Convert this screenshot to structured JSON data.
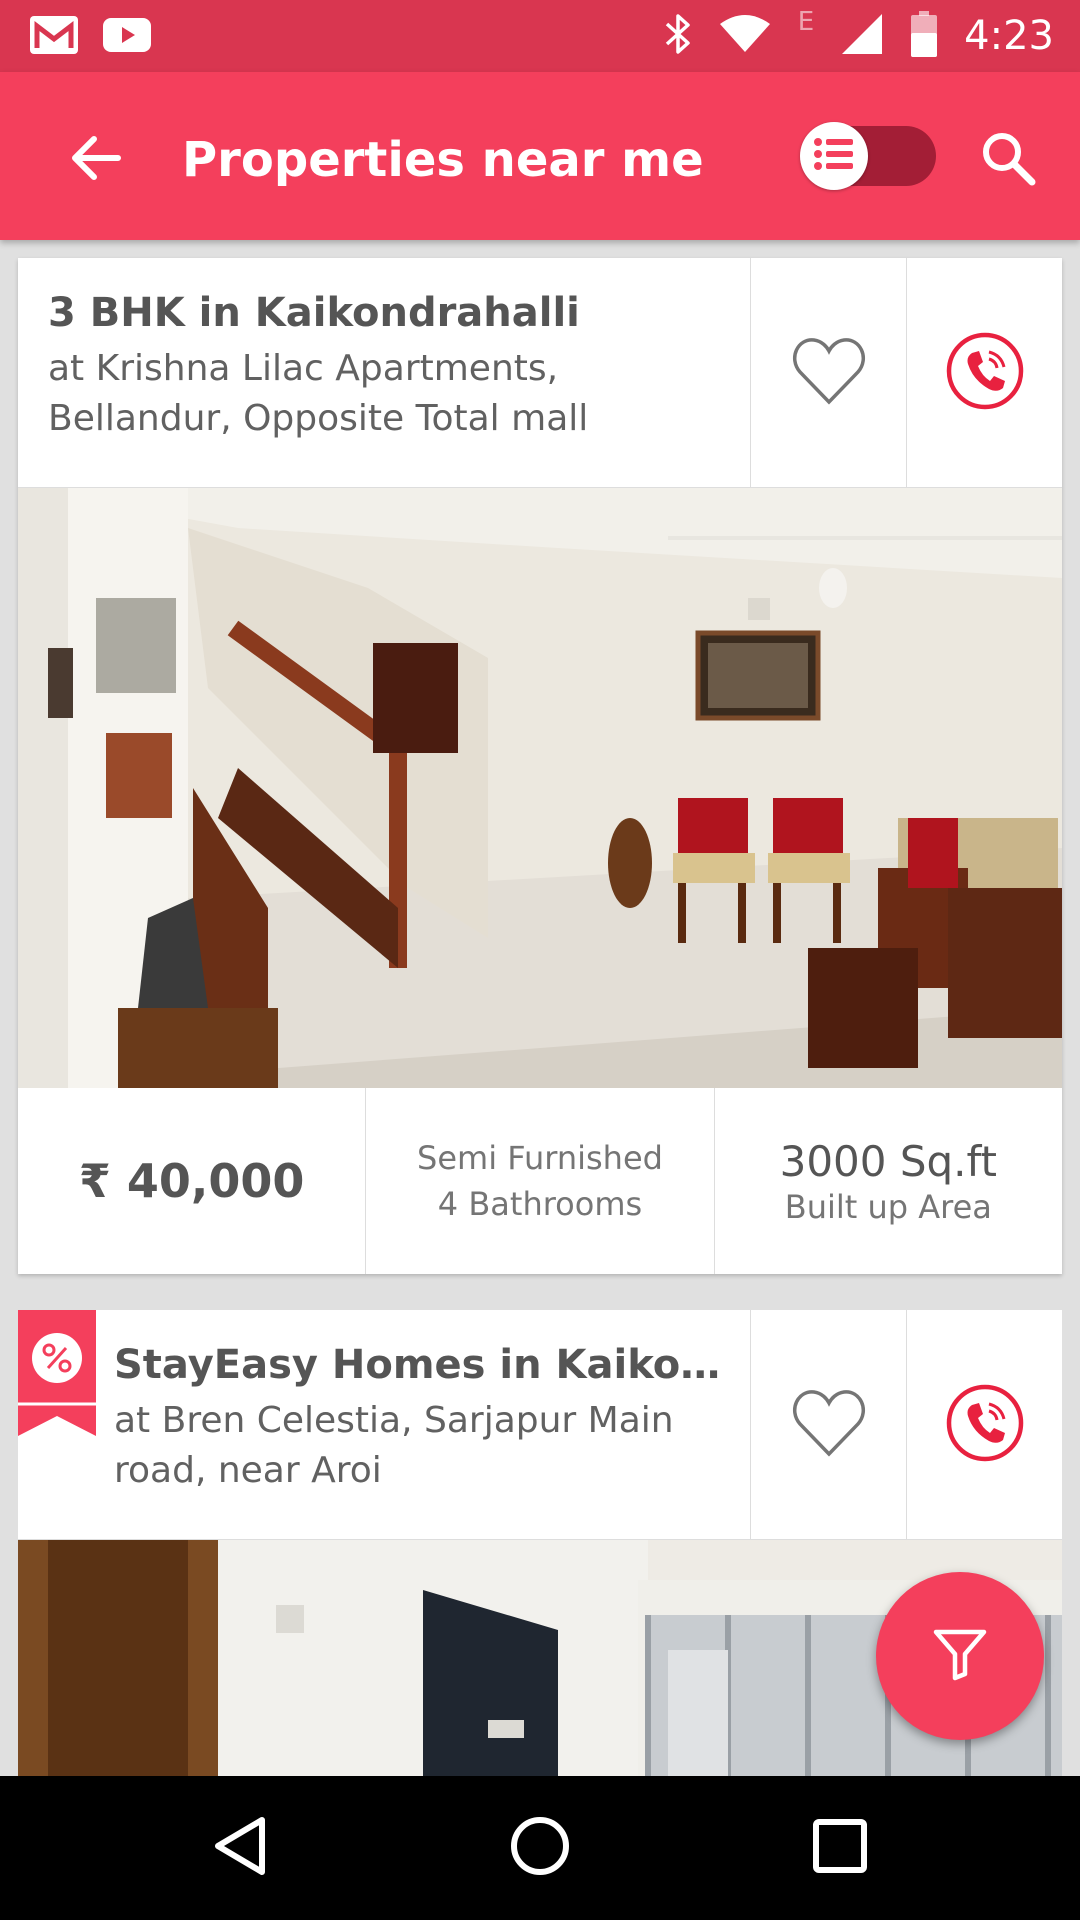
{
  "status_bar": {
    "time": "4:23",
    "network_label": "E",
    "icons": [
      "gmail-icon",
      "youtube-icon",
      "bluetooth-icon",
      "wifi-icon",
      "signal-icon",
      "battery-icon"
    ]
  },
  "app_bar": {
    "title": "Properties near me",
    "back_icon": "arrow-left-icon",
    "toggle_icon": "list-view-icon",
    "search_icon": "search-icon"
  },
  "listings": [
    {
      "title": "3 BHK in Kaikondrahalli",
      "subtitle": "at Krishna Lilac Apartments, Bellandur, Opposite Total mall",
      "price": "₹ 40,000",
      "furnishing": "Semi Furnished",
      "bathrooms": "4 Bathrooms",
      "area": "3000 Sq.ft",
      "area_label": "Built up Area"
    },
    {
      "title": "StayEasy Homes in Kaikon…",
      "subtitle": "at Bren Celestia, Sarjapur Main road, near Aroi",
      "badge_icon": "offer-percent-icon"
    }
  ],
  "fab": {
    "icon": "filter-icon"
  },
  "nav_bar": {
    "icons": [
      "back-triangle-icon",
      "home-circle-icon",
      "recents-square-icon"
    ]
  },
  "colors": {
    "accent": "#f43f5c",
    "status_bar": "#d93650",
    "toggle_track": "#a31e36",
    "call_red": "#e8213f"
  }
}
